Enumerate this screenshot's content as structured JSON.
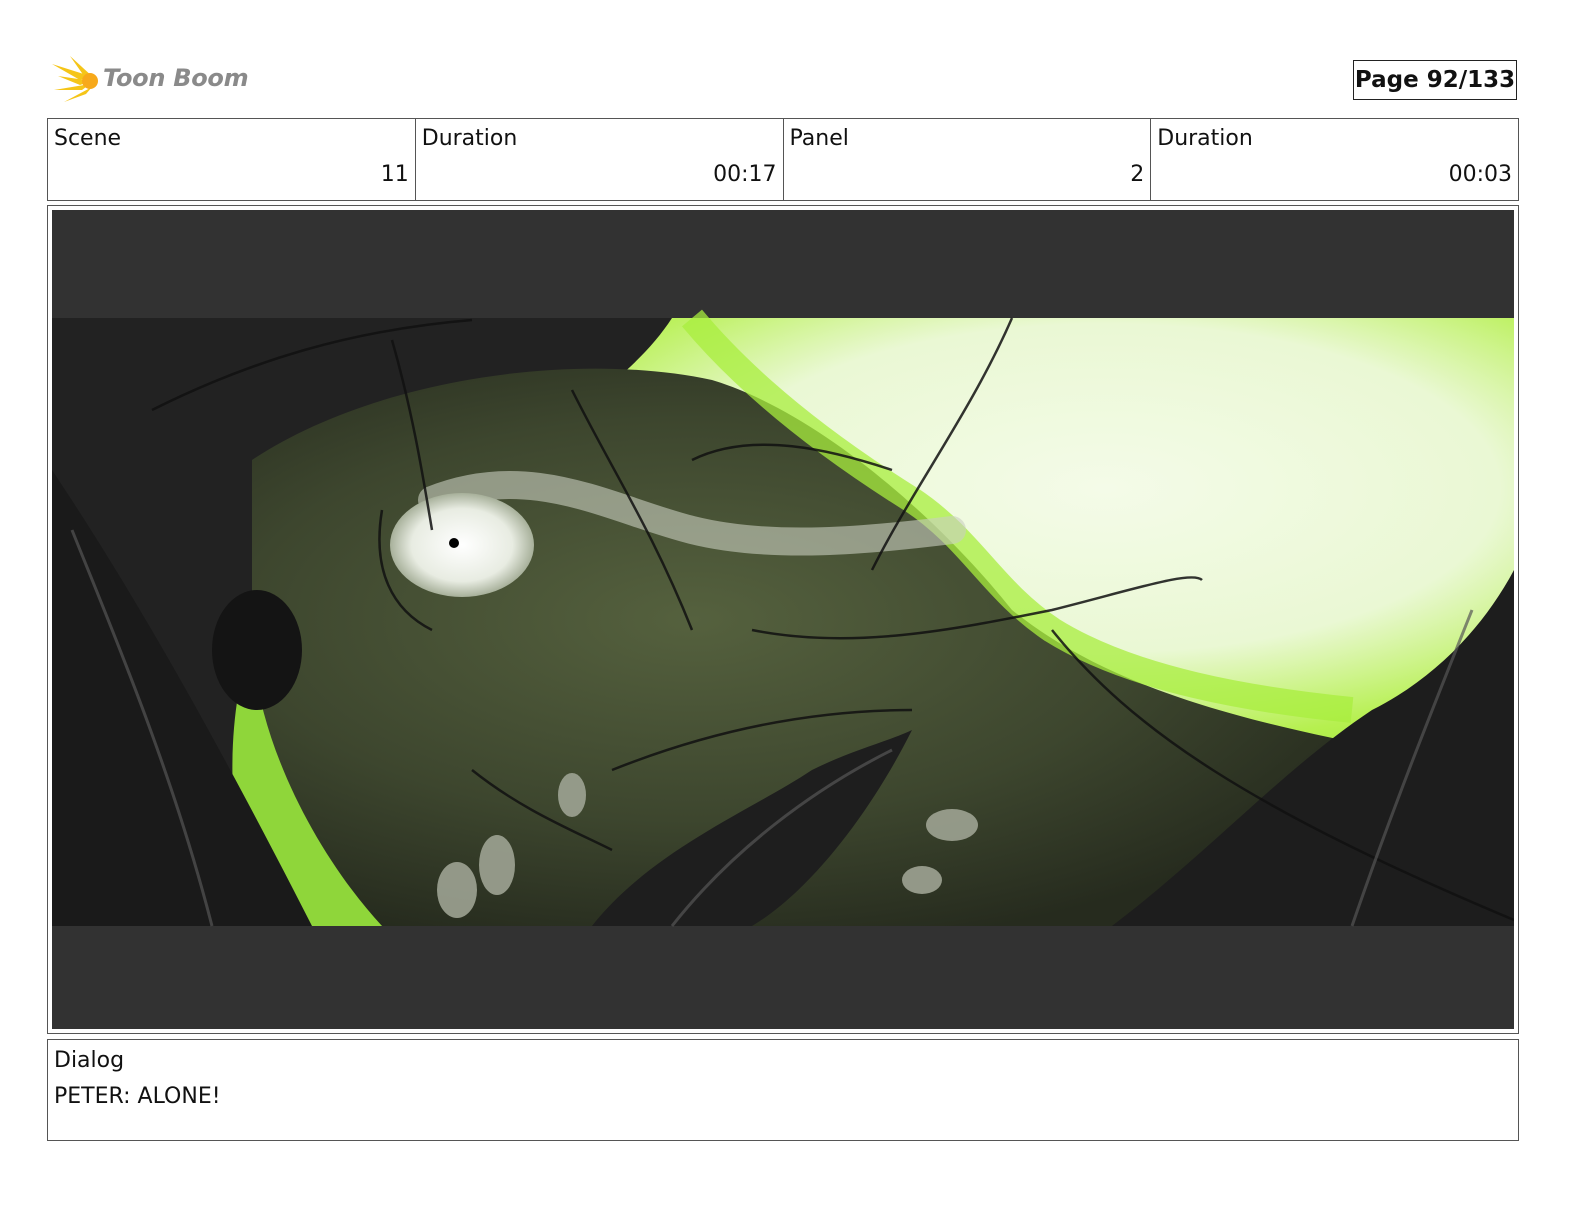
{
  "header": {
    "logo_text": "Toon Boom",
    "page_label": "Page",
    "page_number": "92/133"
  },
  "info": {
    "scene_label": "Scene",
    "scene_value": "11",
    "scene_duration_label": "Duration",
    "scene_duration_value": "00:17",
    "panel_label": "Panel",
    "panel_value": "2",
    "panel_duration_label": "Duration",
    "panel_duration_value": "00:03"
  },
  "dialog": {
    "label": "Dialog",
    "text": "PETER: ALONE!"
  },
  "colors": {
    "accent_yellow": "#f5c518",
    "panel_green": "#9be33a",
    "letterbox": "#2f2f2f"
  }
}
